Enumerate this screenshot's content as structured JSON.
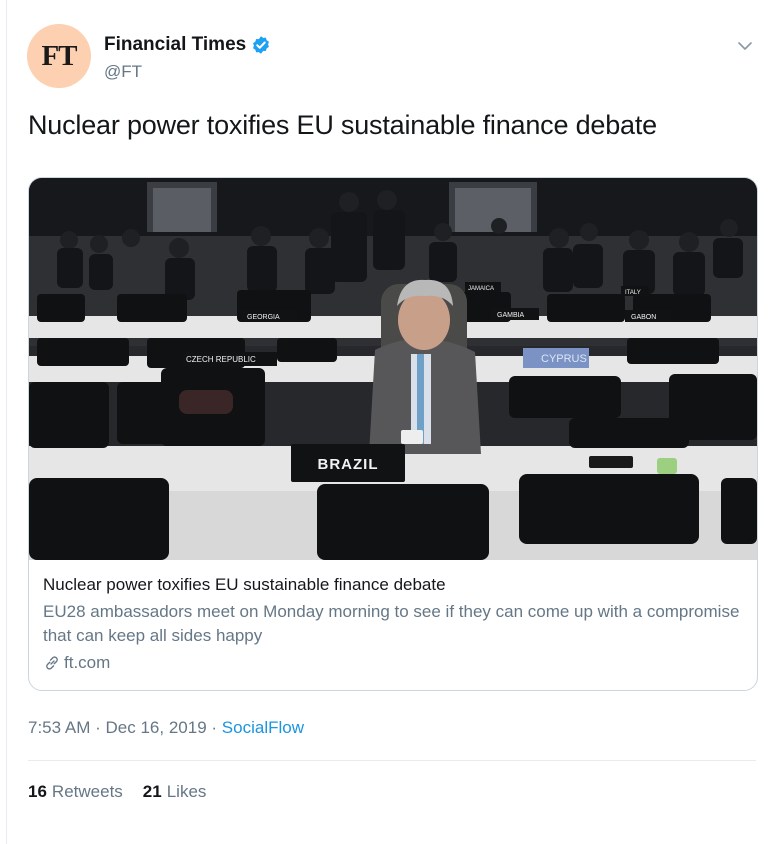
{
  "tweet": {
    "author": {
      "avatar_text": "FT",
      "name": "Financial Times",
      "handle": "@FT",
      "verified": true
    },
    "text": "Nuclear power toxifies EU sustainable finance debate",
    "card": {
      "title": "Nuclear power toxifies EU sustainable finance debate",
      "description": "EU28 ambassadors meet on Monday morning to see if they can come up with a compromise that can keep all sides happy",
      "domain": "ft.com",
      "image": {
        "placards": {
          "brazil": "BRAZIL",
          "czech": "CZECH REPUBLIC",
          "georgia": "GEORGIA",
          "gambia": "GAMBIA",
          "gabon": "GABON",
          "jamaica": "JAMAICA",
          "italy": "ITALY",
          "cyprus": "CYPRUS"
        }
      }
    },
    "time": "7:53 AM",
    "date": "Dec 16, 2019",
    "source": "SocialFlow",
    "separator": "·",
    "stats": {
      "retweets_count": "16",
      "retweets_label": "Retweets",
      "likes_count": "21",
      "likes_label": "Likes"
    }
  },
  "colors": {
    "accent": "#1da1f2",
    "link": "#1b95e0",
    "muted": "#657786",
    "avatar_bg": "#fcd0b1"
  },
  "icons": {
    "verified": "verified-badge-icon",
    "menu": "chevron-down-icon",
    "link": "link-icon"
  }
}
